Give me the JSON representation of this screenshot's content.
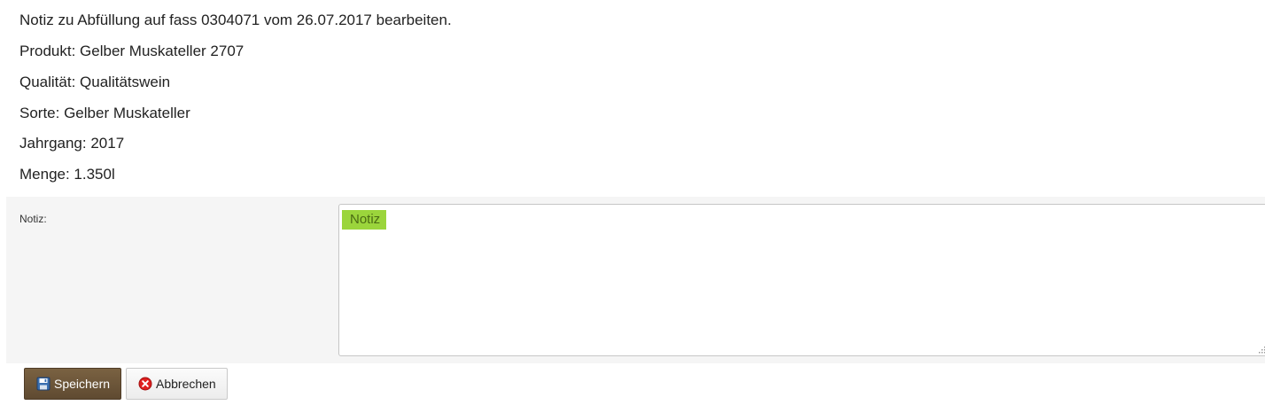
{
  "header": {
    "title": "Notiz zu Abfüllung auf fass 0304071 vom 26.07.2017 bearbeiten.",
    "produkt": "Produkt: Gelber Muskateller 2707",
    "qualitaet": "Qualität: Qualitätswein",
    "sorte": "Sorte: Gelber Muskateller",
    "jahrgang": "Jahrgang: 2017",
    "menge": "Menge: 1.350l"
  },
  "form": {
    "notiz_label": "Notiz:",
    "notiz_placeholder": "Notiz",
    "notiz_value": ""
  },
  "buttons": {
    "save_label": "Speichern",
    "save_icon": "floppy-disk-icon",
    "cancel_label": "Abbrechen",
    "cancel_icon": "cancel-x-icon"
  },
  "colors": {
    "save_button": "#6b5438",
    "placeholder_highlight": "#9bd53c",
    "cancel_icon": "#e02020"
  }
}
